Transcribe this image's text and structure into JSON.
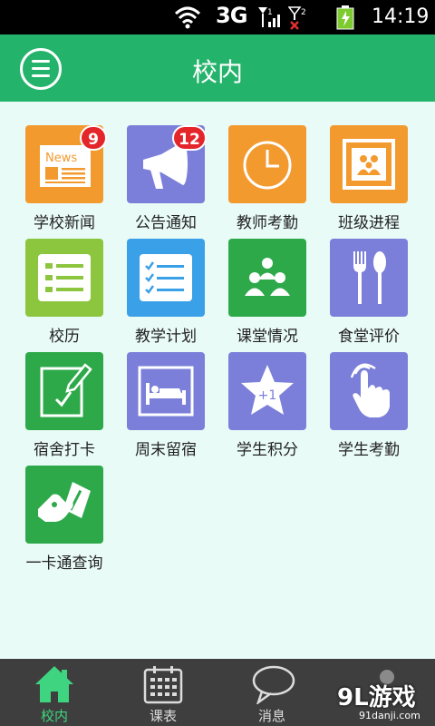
{
  "status_bar": {
    "network": "3G",
    "time": "14:19",
    "icons": [
      "wifi-icon",
      "signal-icon",
      "signal-no-service-icon",
      "battery-charging-icon"
    ]
  },
  "header": {
    "title": "校内",
    "menu_icon": "menu-icon"
  },
  "colors": {
    "header": "#24b36b",
    "background": "#e9fbf7",
    "orange": "#f39a2f",
    "purple": "#7b7fd9",
    "green": "#2ea94a",
    "lightgreen": "#8cc63f",
    "blue": "#3aa0e8",
    "nav_active": "#3fd47f",
    "badge": "#e4262b"
  },
  "apps": [
    {
      "label": "学校新闻",
      "icon": "newspaper-icon",
      "badge": "9"
    },
    {
      "label": "公告通知",
      "icon": "megaphone-icon",
      "badge": "12"
    },
    {
      "label": "教师考勤",
      "icon": "clock-icon"
    },
    {
      "label": "班级进程",
      "icon": "class-photo-icon"
    },
    {
      "label": "校历",
      "icon": "calendar-list-icon"
    },
    {
      "label": "教学计划",
      "icon": "checklist-icon"
    },
    {
      "label": "课堂情况",
      "icon": "classroom-people-icon"
    },
    {
      "label": "食堂评价",
      "icon": "fork-spoon-icon"
    },
    {
      "label": "宿舍打卡",
      "icon": "check-in-pen-icon"
    },
    {
      "label": "周末留宿",
      "icon": "bed-icon"
    },
    {
      "label": "学生积分",
      "icon": "star-plus-one-icon",
      "star_text": "+1"
    },
    {
      "label": "学生考勤",
      "icon": "touch-finger-icon"
    },
    {
      "label": "一卡通查询",
      "icon": "card-hand-icon"
    }
  ],
  "bottom_nav": [
    {
      "label": "校内",
      "icon": "home-icon",
      "active": true
    },
    {
      "label": "课表",
      "icon": "calendar-icon",
      "active": false
    },
    {
      "label": "消息",
      "icon": "chat-bubble-icon",
      "active": false
    }
  ],
  "watermark": {
    "main": "9L游戏",
    "sub": "91danji.com"
  }
}
